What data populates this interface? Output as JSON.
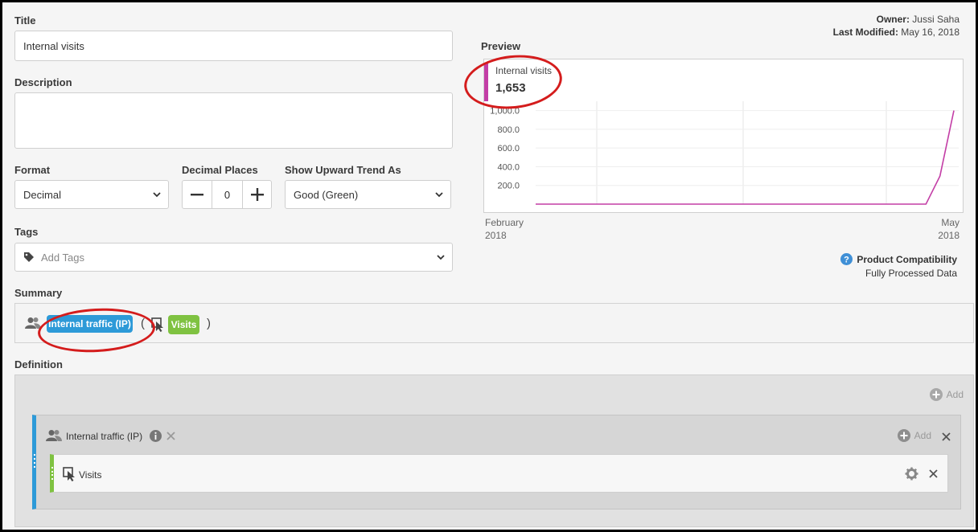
{
  "owner": {
    "label": "Owner:",
    "value": "Jussi Saha"
  },
  "last_modified": {
    "label": "Last Modified:",
    "value": "May 16, 2018"
  },
  "title": {
    "label": "Title",
    "value": "Internal visits"
  },
  "description": {
    "label": "Description",
    "value": ""
  },
  "format": {
    "label": "Format",
    "value": "Decimal"
  },
  "decimal_places": {
    "label": "Decimal Places",
    "value": "0"
  },
  "trend": {
    "label": "Show Upward Trend As",
    "value": "Good (Green)"
  },
  "tags": {
    "label": "Tags",
    "placeholder": "Add Tags"
  },
  "summary": {
    "label": "Summary",
    "segment": "Internal traffic (IP)",
    "open_paren": "(",
    "metric": "Visits",
    "close_paren": ")"
  },
  "definition": {
    "label": "Definition",
    "add_label": "Add",
    "container": {
      "name": "Internal traffic (IP)",
      "add_label": "Add"
    },
    "item": {
      "name": "Visits"
    }
  },
  "preview": {
    "label": "Preview",
    "metric_name": "Internal visits",
    "total": "1,653",
    "y_ticks": [
      "200.0",
      "400.0",
      "600.0",
      "800.0",
      "1,000.0"
    ],
    "x_start": [
      "February",
      "2018"
    ],
    "x_end": [
      "May",
      "2018"
    ]
  },
  "compatibility": {
    "title": "Product Compatibility",
    "value": "Fully Processed Data"
  },
  "colors": {
    "accent_blue": "#2d9ad8",
    "accent_green": "#7fc241",
    "line": "#c33ea6",
    "annotation": "#d41c1c"
  },
  "chart_data": {
    "type": "line",
    "series": [
      {
        "name": "Internal visits",
        "values": [
          0,
          0,
          0,
          0,
          0,
          0,
          0,
          0,
          0,
          0,
          0,
          0,
          0,
          0,
          0,
          0,
          0,
          0,
          0,
          0,
          0,
          0,
          0,
          0,
          0,
          0,
          0,
          0,
          0,
          300,
          1000
        ]
      }
    ],
    "ylim": [
      0,
      1100
    ]
  }
}
